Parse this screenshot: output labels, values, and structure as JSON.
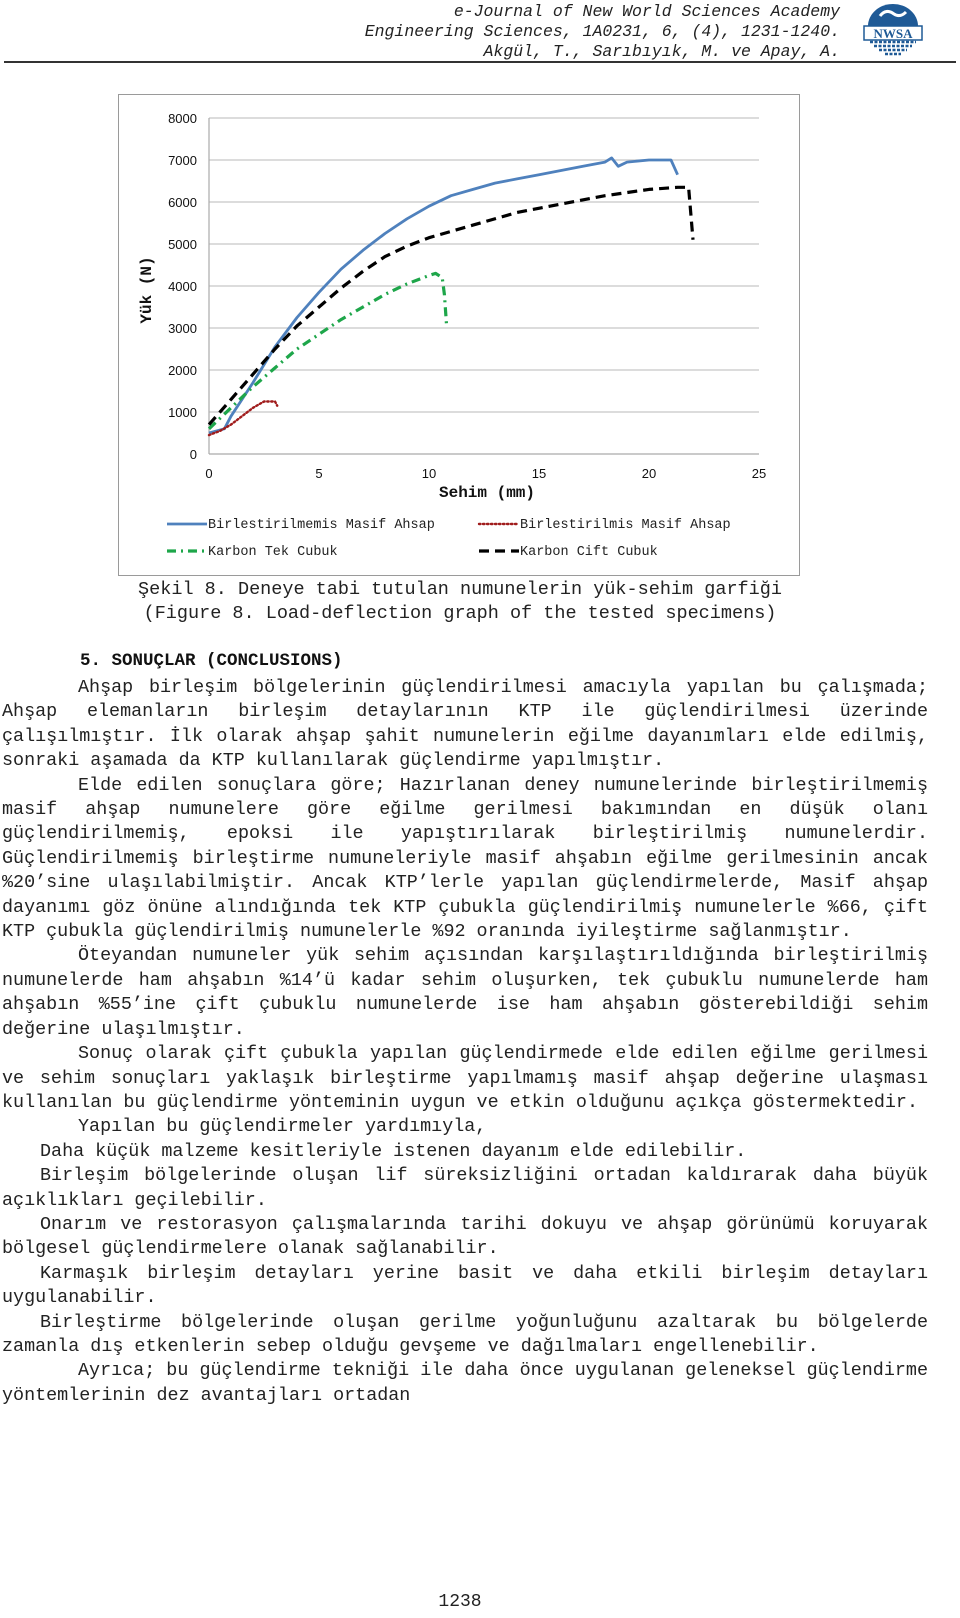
{
  "header": {
    "lines": [
      "e-Journal of New World Sciences Academy",
      "Engineering Sciences, 1A0231, 6, (4), 1231-1240.",
      "Akgül, T., Sarıbıyık, M. ve Apay, A."
    ],
    "logo_text": "NWSA",
    "logo_icon": "globe-logo-icon"
  },
  "chart_data": {
    "type": "line",
    "title": "",
    "xlabel": "Sehim (mm)",
    "ylabel": "Yük (N)",
    "xlim": [
      0,
      25
    ],
    "ylim": [
      0,
      8000
    ],
    "xticks": [
      "0",
      "5",
      "10",
      "15",
      "20",
      "25"
    ],
    "yticks": [
      "0",
      "1000",
      "2000",
      "3000",
      "4000",
      "5000",
      "6000",
      "7000",
      "8000"
    ],
    "grid": "horizontal",
    "legend_position": "bottom",
    "series": [
      {
        "name": "Birlestirilmemis Masif Ahsap",
        "color": "#4f81bd",
        "style": "solid",
        "points": [
          [
            0,
            500
          ],
          [
            0.7,
            600
          ],
          [
            1,
            900
          ],
          [
            2,
            1700
          ],
          [
            3,
            2550
          ],
          [
            4,
            3250
          ],
          [
            5,
            3850
          ],
          [
            6,
            4400
          ],
          [
            7,
            4850
          ],
          [
            8,
            5250
          ],
          [
            9,
            5600
          ],
          [
            10,
            5900
          ],
          [
            11,
            6150
          ],
          [
            12,
            6300
          ],
          [
            13,
            6450
          ],
          [
            14,
            6550
          ],
          [
            15,
            6650
          ],
          [
            16,
            6750
          ],
          [
            17,
            6850
          ],
          [
            18,
            6950
          ],
          [
            18.3,
            7050
          ],
          [
            18.6,
            6850
          ],
          [
            19,
            6950
          ],
          [
            20,
            7000
          ],
          [
            21,
            7000
          ],
          [
            21.3,
            6650
          ]
        ]
      },
      {
        "name": "Birlestirilmis Masif Ahsap",
        "color": "#a01c1c",
        "style": "dotted",
        "points": [
          [
            0,
            450
          ],
          [
            0.5,
            550
          ],
          [
            1,
            700
          ],
          [
            1.5,
            900
          ],
          [
            2,
            1100
          ],
          [
            2.5,
            1250
          ],
          [
            3,
            1250
          ],
          [
            3.1,
            1150
          ]
        ]
      },
      {
        "name": "Karbon Tek Cubuk",
        "color": "#1ea64a",
        "style": "dashdot",
        "points": [
          [
            0,
            600
          ],
          [
            1,
            1100
          ],
          [
            2,
            1600
          ],
          [
            3,
            2050
          ],
          [
            4,
            2500
          ],
          [
            5,
            2850
          ],
          [
            6,
            3200
          ],
          [
            7,
            3500
          ],
          [
            8,
            3800
          ],
          [
            9,
            4050
          ],
          [
            10,
            4250
          ],
          [
            10.3,
            4300
          ],
          [
            10.6,
            4200
          ],
          [
            10.7,
            3800
          ],
          [
            10.8,
            3050
          ]
        ]
      },
      {
        "name": "Karbon Cift Cubuk",
        "color": "#000000",
        "style": "dashed",
        "points": [
          [
            0,
            700
          ],
          [
            1,
            1300
          ],
          [
            2,
            1900
          ],
          [
            3,
            2500
          ],
          [
            4,
            3050
          ],
          [
            5,
            3500
          ],
          [
            6,
            3950
          ],
          [
            7,
            4350
          ],
          [
            8,
            4700
          ],
          [
            9,
            4950
          ],
          [
            10,
            5150
          ],
          [
            12,
            5450
          ],
          [
            14,
            5750
          ],
          [
            16,
            5950
          ],
          [
            18,
            6150
          ],
          [
            20,
            6300
          ],
          [
            21.3,
            6350
          ],
          [
            21.8,
            6350
          ],
          [
            22,
            5100
          ]
        ]
      }
    ]
  },
  "caption": {
    "line1": "Şekil 8. Deneye tabi tutulan numunelerin yük-sehim garfiği",
    "line2": "(Figure 8. Load-deflection graph of the tested specimens)"
  },
  "section": {
    "title": "5. SONUÇLAR (CONCLUSIONS)"
  },
  "paragraphs": [
    {
      "style": "indent",
      "text": "Ahşap birleşim bölgelerinin güçlendirilmesi amacıyla yapılan bu çalışmada; Ahşap elemanların birleşim detaylarının KTP ile güçlendirilmesi üzerinde çalışılmıştır. İlk olarak ahşap şahit numunelerin eğilme dayanımları elde edilmiş, sonraki aşamada da KTP kullanılarak güçlendirme yapılmıştır."
    },
    {
      "style": "indent",
      "text": "Elde edilen sonuçlara göre; Hazırlanan deney numunelerinde birleştirilmemiş masif ahşap numunelere göre eğilme gerilmesi bakımından en düşük olanı güçlendirilmemiş, epoksi ile yapıştırılarak birleştirilmiş numunelerdir. Güçlendirilmemiş birleştirme numuneleriyle masif ahşabın eğilme gerilmesinin ancak %20’sine ulaşılabilmiştir. Ancak KTP’lerle yapılan güçlendirmelerde, Masif ahşap dayanımı göz önüne alındığında tek KTP çubukla güçlendirilmiş numunelerle %66, çift KTP çubukla güçlendirilmiş numunelerle %92 oranında iyileştirme sağlanmıştır."
    },
    {
      "style": "indent",
      "text": "Öteyandan numuneler yük sehim açısından karşılaştırıldığında birleştirilmiş numunelerde ham ahşabın %14’ü kadar sehim oluşurken, tek çubuklu numunelerde ham ahşabın %55’ine çift çubuklu numunelerde ise ham ahşabın gösterebildiği sehim değerine ulaşılmıştır."
    },
    {
      "style": "indent",
      "text": "Sonuç olarak çift çubukla yapılan güçlendirmede elde edilen eğilme gerilmesi ve sehim sonuçları yaklaşık birleştirme yapılmamış masif ahşap değerine ulaşması kullanılan bu güçlendirme yönteminin uygun ve etkin olduğunu açıkça göstermektedir."
    },
    {
      "style": "indent",
      "text": "Yapılan bu güçlendirmeler yardımıyla,"
    },
    {
      "style": "bullet",
      "text": "Daha küçük malzeme kesitleriyle istenen dayanım elde edilebilir."
    },
    {
      "style": "bullet",
      "text": "Birleşim bölgelerinde oluşan lif süreksizliğini ortadan kaldırarak daha büyük açıklıkları geçilebilir."
    },
    {
      "style": "bullet",
      "text": "Onarım ve restorasyon çalışmalarında tarihi dokuyu ve ahşap görünümü koruyarak bölgesel güçlendirmelere olanak sağlanabilir."
    },
    {
      "style": "bullet",
      "text": "Karmaşık birleşim detayları yerine basit ve daha etkili birleşim detayları uygulanabilir."
    },
    {
      "style": "bullet",
      "text": "Birleştirme bölgelerinde oluşan gerilme yoğunluğunu azaltarak bu bölgelerde zamanla dış etkenlerin sebep olduğu gevşeme ve dağılmaları engellenebilir."
    },
    {
      "style": "indent",
      "text": "Ayrıca; bu güçlendirme tekniği ile daha önce uygulanan geleneksel güçlendirme yöntemlerinin dez avantajları ortadan"
    }
  ],
  "page_number": "1238"
}
